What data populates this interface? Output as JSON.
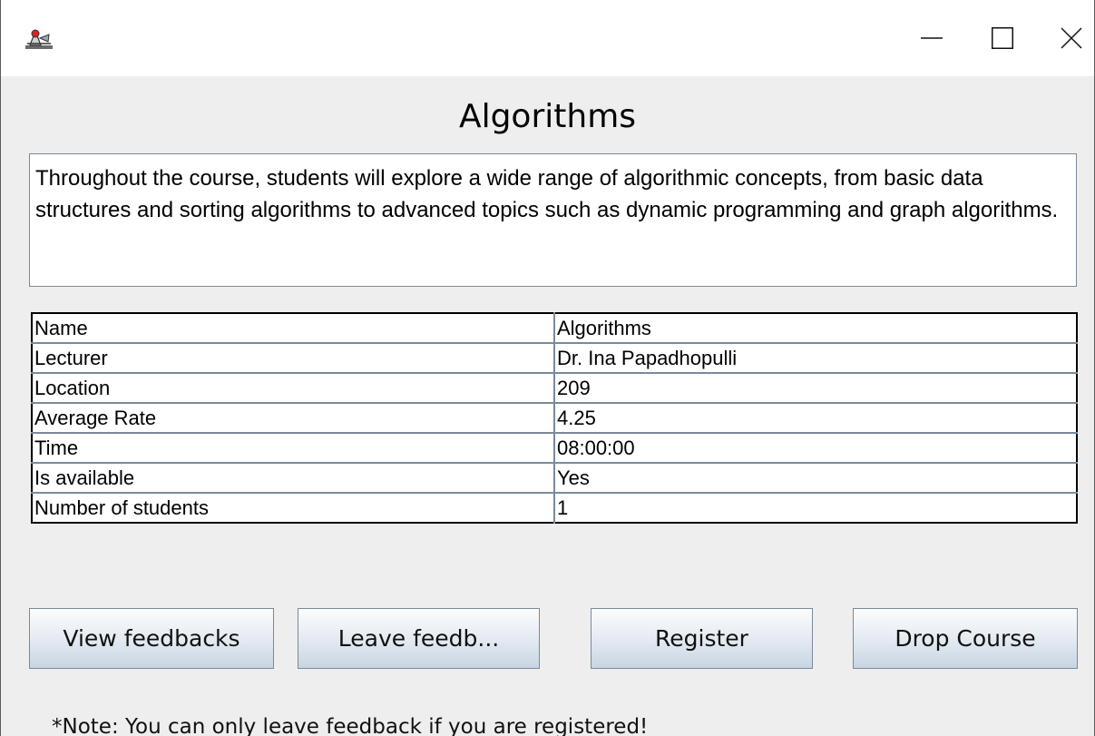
{
  "window": {
    "icon": "java-duke-icon",
    "controls": [
      "minimize-icon",
      "maximize-icon",
      "close-icon"
    ]
  },
  "course": {
    "title": "Algorithms",
    "description": "Throughout the course, students will explore a wide range of algorithmic concepts, from basic data structures and sorting algorithms to advanced topics such as dynamic programming and graph algorithms."
  },
  "details": [
    {
      "label": "Name",
      "value": "Algorithms"
    },
    {
      "label": "Lecturer",
      "value": "Dr. Ina Papadhopulli"
    },
    {
      "label": "Location",
      "value": "209"
    },
    {
      "label": "Average Rate",
      "value": "4.25"
    },
    {
      "label": "Time",
      "value": "08:00:00"
    },
    {
      "label": "Is available",
      "value": "Yes"
    },
    {
      "label": "Number of students",
      "value": "1"
    }
  ],
  "actions": {
    "view_feedbacks": "View feedbacks",
    "leave_feedback": "Leave feedb...",
    "register": "Register",
    "drop_course": "Drop Course"
  },
  "note": "*Note: You can only leave feedback if you are registered!"
}
